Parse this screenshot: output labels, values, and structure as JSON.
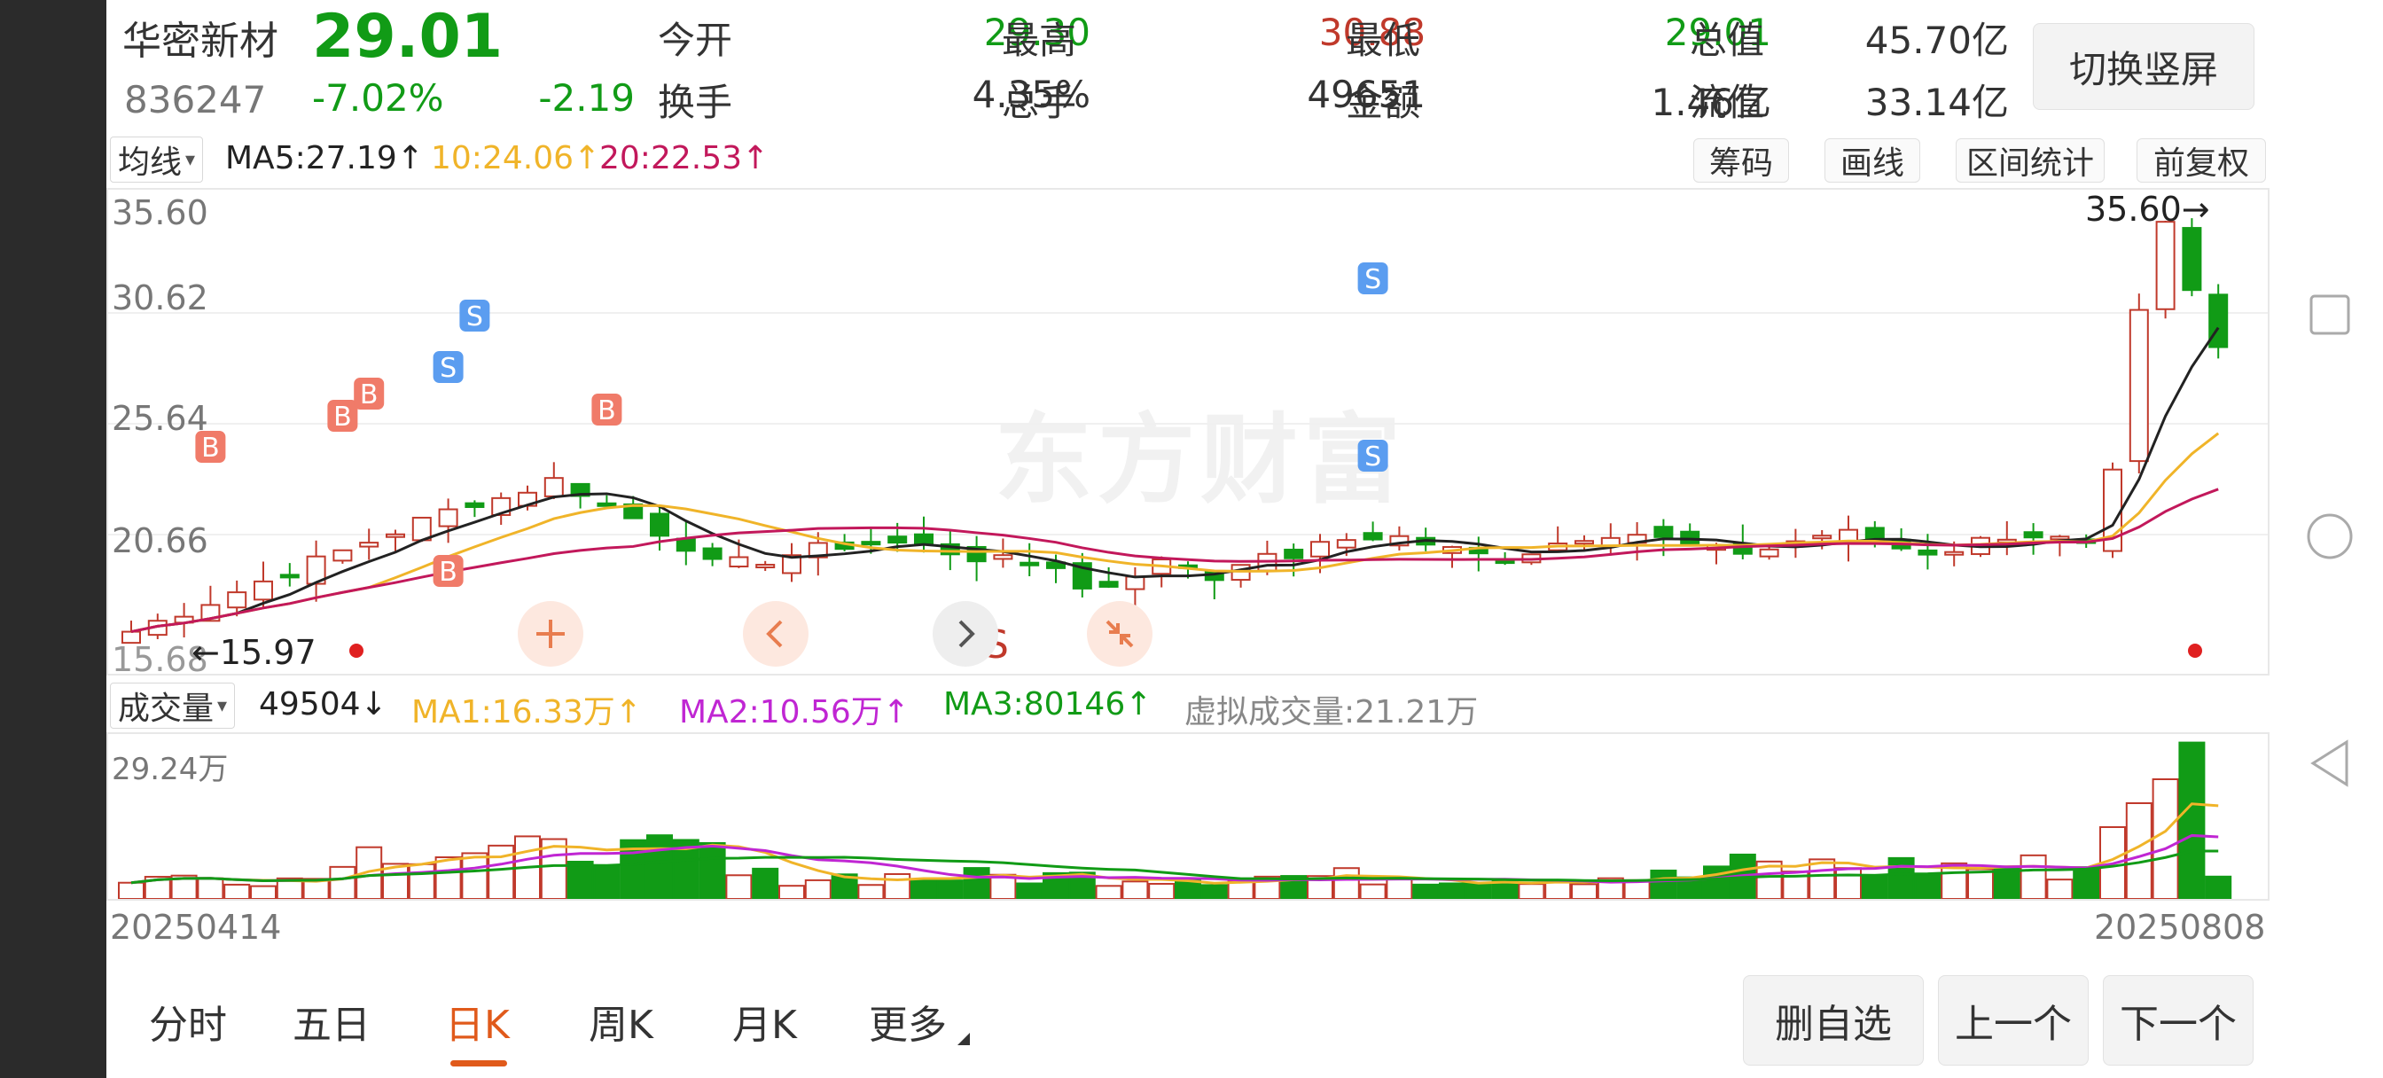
{
  "stock": {
    "name": "华密新材",
    "price": "29.01",
    "code": "836247",
    "change_pct": "-7.02%",
    "change": "-2.19"
  },
  "quote": {
    "open_label": "今开",
    "open": "29.30",
    "high_label": "最高",
    "high": "30.88",
    "low_label": "最低",
    "low": "29.01",
    "mktcap_label": "总值",
    "mktcap": "45.70亿",
    "turnover_label": "换手",
    "turnover": "4.35%",
    "volume_label": "总手",
    "volume": "49651",
    "amount_label": "金额",
    "amount": "1.46亿",
    "float_label": "流值",
    "float": "33.14亿"
  },
  "switch_button": "切换竖屏",
  "ma_bar": {
    "selector": "均线",
    "ma5": "MA5:27.19↑",
    "ma10": "10:24.06↑",
    "ma20": "20:22.53↑"
  },
  "tools": {
    "chips": "筹码",
    "draw": "画线",
    "range_stats": "区间统计",
    "adjust": "前复权"
  },
  "price_axis": {
    "l1": "35.60",
    "l2": "30.62",
    "l3": "25.64",
    "l4": "20.66",
    "l5": "15.68"
  },
  "annotations": {
    "high": "35.60",
    "low": "15.97",
    "sell_marker": "S"
  },
  "watermark": "东方财富",
  "volume_bar": {
    "selector": "成交量",
    "vol": "49504↓",
    "ma1": "MA1:16.33万↑",
    "ma2": "MA2:10.56万↑",
    "ma3": "MA3:80146↑",
    "virtual": "虚拟成交量:21.21万"
  },
  "volume_axis": {
    "max": "29.24万"
  },
  "dates": {
    "start": "20250414",
    "end": "20250808"
  },
  "tabs": [
    "分时",
    "五日",
    "日K",
    "周K",
    "月K",
    "更多"
  ],
  "bottom_buttons": {
    "delete": "删自选",
    "prev": "上一个",
    "next": "下一个"
  },
  "colors": {
    "up": "#c0392b",
    "down": "#119b16",
    "ma5": "#222222",
    "ma10": "#f0b429",
    "ma20": "#c2185b",
    "accent": "#e05a1b",
    "buy_badge": "#f07b69",
    "sell_badge": "#5b9df0"
  }
}
